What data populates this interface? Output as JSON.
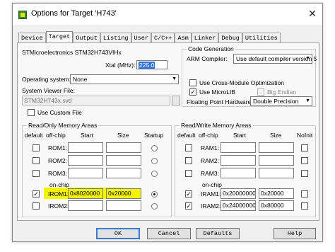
{
  "window": {
    "title": "Options for Target 'H743'",
    "close": "✕"
  },
  "tabs": [
    "Device",
    "Target",
    "Output",
    "Listing",
    "User",
    "C/C++",
    "Asm",
    "Linker",
    "Debug",
    "Utilities"
  ],
  "target": {
    "device_name": "STMicroelectronics STM32H743VIHx",
    "xtal_label": "Xtal (MHz):",
    "xtal_value": "225.0",
    "os_label": "Operating system:",
    "os_value": "None",
    "svf_label": "System Viewer File:",
    "svf_value": "STM32H743x.svd",
    "custom_file_label": "Use Custom File"
  },
  "code_gen": {
    "title": "Code Generation",
    "arm_compiler_label": "ARM Compiler:",
    "arm_compiler_value": "Use default compiler version 5",
    "cross_module_label": "Use Cross-Module Optimization",
    "microlib_label": "Use MicroLIB",
    "big_endian_label": "Big Endian",
    "fph_label": "Floating Point Hardware:",
    "fph_value": "Double Precision"
  },
  "rom": {
    "title": "Read/Only Memory Areas",
    "headers": {
      "default": "default",
      "offchip": "off-chip",
      "start": "Start",
      "size": "Size",
      "startup": "Startup"
    },
    "onchip_label": "on-chip",
    "rows": [
      {
        "name": "ROM1:",
        "start": "",
        "size": ""
      },
      {
        "name": "ROM2:",
        "start": "",
        "size": ""
      },
      {
        "name": "ROM3:",
        "start": "",
        "size": ""
      },
      {
        "name": "IROM1:",
        "start": "0x8020000",
        "size": "0x20000"
      },
      {
        "name": "IROM2:",
        "start": "",
        "size": ""
      }
    ]
  },
  "ram": {
    "title": "Read/Write Memory Areas",
    "headers": {
      "default": "default",
      "offchip": "off-chip",
      "start": "Start",
      "size": "Size",
      "noinit": "NoInit"
    },
    "onchip_label": "on-chip",
    "rows": [
      {
        "name": "RAM1:",
        "start": "",
        "size": ""
      },
      {
        "name": "RAM2:",
        "start": "",
        "size": ""
      },
      {
        "name": "RAM3:",
        "start": "",
        "size": ""
      },
      {
        "name": "IRAM1:",
        "start": "0x20000000",
        "size": "0x20000"
      },
      {
        "name": "IRAM2:",
        "start": "0x24000000",
        "size": "0x80000"
      }
    ]
  },
  "buttons": {
    "ok": "OK",
    "cancel": "Cancel",
    "defaults": "Defaults",
    "help": "Help"
  },
  "colors": {
    "highlight": "#f5f500",
    "selection": "#3372d8"
  }
}
